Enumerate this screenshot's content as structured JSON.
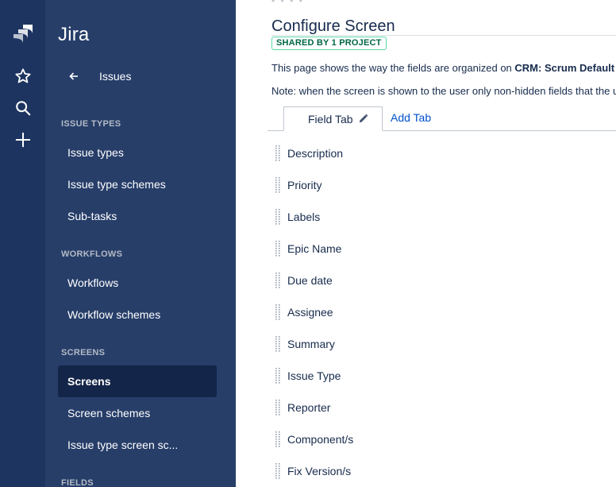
{
  "rail": {
    "logo_icon": "jira-logo-icon",
    "buttons": [
      {
        "icon": "star-icon"
      },
      {
        "icon": "search-icon"
      },
      {
        "icon": "plus-icon"
      }
    ]
  },
  "sidebar": {
    "product": "Jira",
    "back_label": "Issues",
    "sections": [
      {
        "heading": "ISSUE TYPES",
        "items": [
          {
            "label": "Issue types",
            "active": false
          },
          {
            "label": "Issue type schemes",
            "active": false
          },
          {
            "label": "Sub-tasks",
            "active": false
          }
        ]
      },
      {
        "heading": "WORKFLOWS",
        "items": [
          {
            "label": "Workflows",
            "active": false
          },
          {
            "label": "Workflow schemes",
            "active": false
          }
        ]
      },
      {
        "heading": "SCREENS",
        "items": [
          {
            "label": "Screens",
            "active": true
          },
          {
            "label": "Screen schemes",
            "active": false
          },
          {
            "label": "Issue type screen sc...",
            "active": false
          }
        ]
      },
      {
        "heading": "FIELDS",
        "items": []
      }
    ]
  },
  "main": {
    "top_dots": "• • • •",
    "title": "Configure Screen",
    "lozenge": "SHARED BY 1 PROJECT",
    "description_prefix": "This page shows the way the fields are organized on ",
    "description_bold": "CRM: Scrum Default Issue Screen",
    "note": "Note: when the screen is shown to the user only non-hidden fields that the user has permission to see will be displayed.",
    "tabs": {
      "active_label": "Field Tab",
      "add_label": "Add Tab"
    },
    "fields": [
      "Description",
      "Priority",
      "Labels",
      "Epic Name",
      "Due date",
      "Assignee",
      "Summary",
      "Issue Type",
      "Reporter",
      "Component/s",
      "Fix Version/s"
    ]
  },
  "colors": {
    "rail_bg": "#1d3461",
    "sidebar_bg": "#273e69",
    "active_item_bg": "#132548",
    "link": "#0052cc",
    "lozenge_border": "#57d9a3",
    "lozenge_text": "#006644"
  }
}
